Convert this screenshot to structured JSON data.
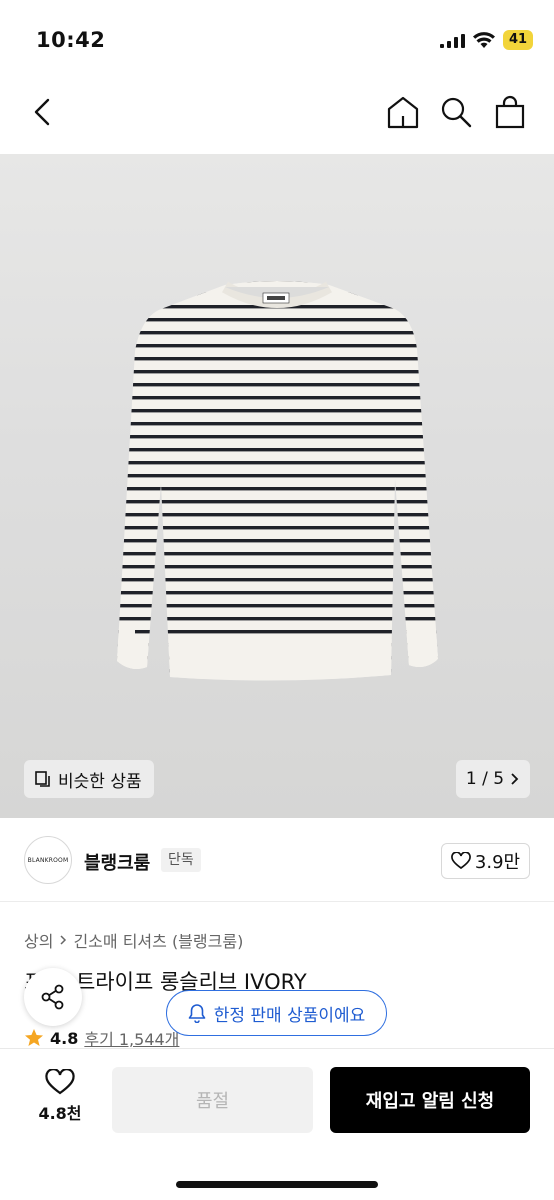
{
  "status_bar": {
    "time": "10:42",
    "battery": "41"
  },
  "nav": {
    "back_icon": "chevron-left-icon",
    "home_icon": "home-icon",
    "search_icon": "search-icon",
    "bag_icon": "shopping-bag-icon"
  },
  "hero": {
    "similar_label": "비슷한 상품",
    "pager": "1 / 5"
  },
  "brand": {
    "logo_text": "BLANKROOM",
    "name": "블랭크룸",
    "badge": "단독",
    "likes": "3.9만"
  },
  "breadcrumb": [
    "상의",
    "긴소매 티셔츠 (블랭크룸)"
  ],
  "product": {
    "title": "프··스트라이프 롱슬리브 IVORY",
    "rating": "4.8",
    "reviews": "후기 1,544개"
  },
  "limited_notice": "한정 판매 상품이에요",
  "bottom_bar": {
    "wish_count": "4.8천",
    "soldout_label": "품절",
    "restock_label": "재입고 알림 신청"
  },
  "colors": {
    "accent_blue": "#1f5cd1",
    "star": "#f5a623",
    "cta": "#000000"
  }
}
